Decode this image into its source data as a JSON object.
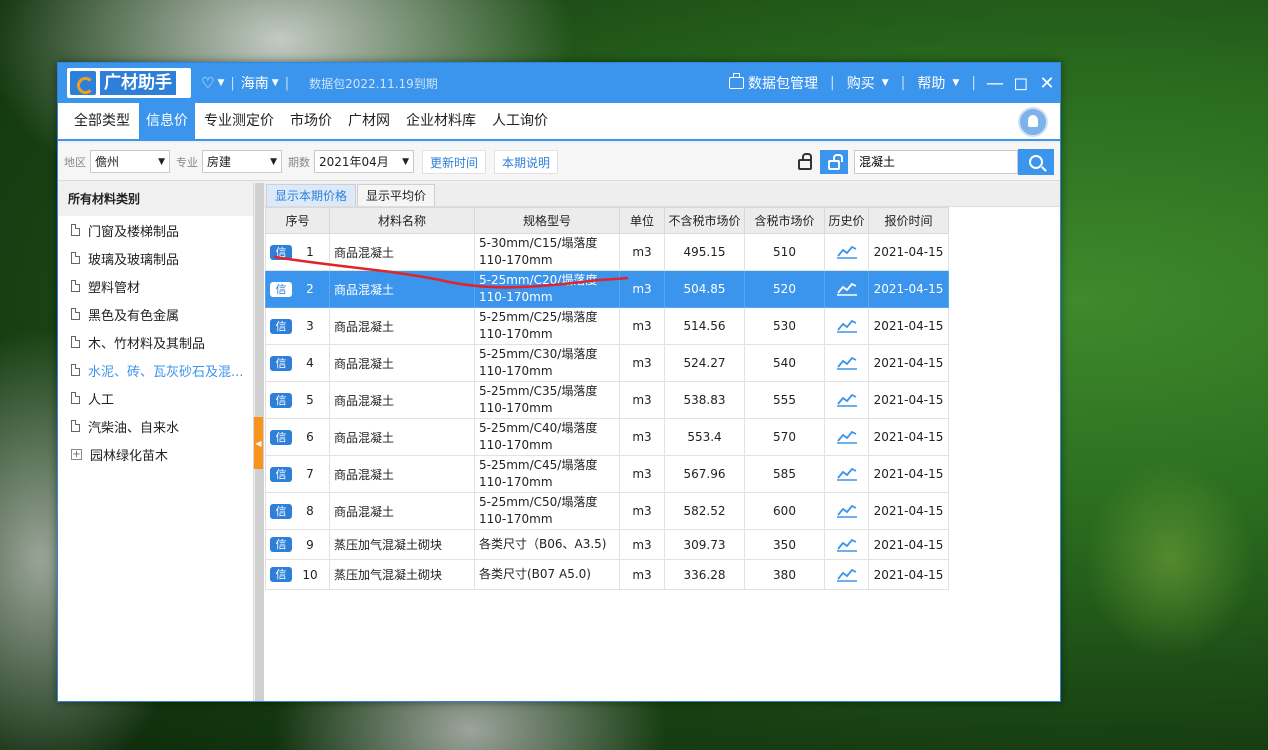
{
  "titlebar": {
    "logo": "广材助手",
    "region": "海南",
    "expire": "数据包2022.11.19到期",
    "package_mgmt": "数据包管理",
    "buy": "购买",
    "help": "帮助"
  },
  "tabs": [
    "全部类型",
    "信息价",
    "专业测定价",
    "市场价",
    "广材网",
    "企业材料库",
    "人工询价"
  ],
  "filters": {
    "area_label": "地区",
    "area_value": "儋州",
    "major_label": "专业",
    "major_value": "房建",
    "period_label": "期数",
    "period_value": "2021年04月",
    "update_btn": "更新时间",
    "desc_btn": "本期说明",
    "search_value": "混凝土"
  },
  "sidebar": {
    "header": "所有材料类别",
    "items": [
      {
        "label": "门窗及楼梯制品"
      },
      {
        "label": "玻璃及玻璃制品"
      },
      {
        "label": "塑料管材"
      },
      {
        "label": "黑色及有色金属"
      },
      {
        "label": "木、竹材料及其制品"
      },
      {
        "label": "水泥、砖、瓦灰砂石及混..."
      },
      {
        "label": "人工"
      },
      {
        "label": "汽柴油、自来水"
      },
      {
        "label": "园林绿化苗木"
      }
    ]
  },
  "subtabs": [
    "显示本期价格",
    "显示平均价"
  ],
  "table": {
    "headers": [
      "序号",
      "材料名称",
      "规格型号",
      "单位",
      "不含税市场价",
      "含税市场价",
      "历史价",
      "报价时间"
    ],
    "badge": "信",
    "rows": [
      {
        "idx": "1",
        "name": "商品混凝土",
        "spec1": "5-30mm/C15/塌落度",
        "spec2": "110-170mm",
        "unit": "m3",
        "price_ex": "495.15",
        "price_in": "510",
        "date": "2021-04-15"
      },
      {
        "idx": "2",
        "name": "商品混凝土",
        "spec1": "5-25mm/C20/塌落度",
        "spec2": "110-170mm",
        "unit": "m3",
        "price_ex": "504.85",
        "price_in": "520",
        "date": "2021-04-15"
      },
      {
        "idx": "3",
        "name": "商品混凝土",
        "spec1": "5-25mm/C25/塌落度",
        "spec2": "110-170mm",
        "unit": "m3",
        "price_ex": "514.56",
        "price_in": "530",
        "date": "2021-04-15"
      },
      {
        "idx": "4",
        "name": "商品混凝土",
        "spec1": "5-25mm/C30/塌落度",
        "spec2": "110-170mm",
        "unit": "m3",
        "price_ex": "524.27",
        "price_in": "540",
        "date": "2021-04-15"
      },
      {
        "idx": "5",
        "name": "商品混凝土",
        "spec1": "5-25mm/C35/塌落度",
        "spec2": "110-170mm",
        "unit": "m3",
        "price_ex": "538.83",
        "price_in": "555",
        "date": "2021-04-15"
      },
      {
        "idx": "6",
        "name": "商品混凝土",
        "spec1": "5-25mm/C40/塌落度",
        "spec2": "110-170mm",
        "unit": "m3",
        "price_ex": "553.4",
        "price_in": "570",
        "date": "2021-04-15"
      },
      {
        "idx": "7",
        "name": "商品混凝土",
        "spec1": "5-25mm/C45/塌落度",
        "spec2": "110-170mm",
        "unit": "m3",
        "price_ex": "567.96",
        "price_in": "585",
        "date": "2021-04-15"
      },
      {
        "idx": "8",
        "name": "商品混凝土",
        "spec1": "5-25mm/C50/塌落度",
        "spec2": "110-170mm",
        "unit": "m3",
        "price_ex": "582.52",
        "price_in": "600",
        "date": "2021-04-15"
      },
      {
        "idx": "9",
        "name": "蒸压加气混凝土砌块",
        "spec1": "各类尺寸（B06、A3.5)",
        "spec2": "",
        "unit": "m3",
        "price_ex": "309.73",
        "price_in": "350",
        "date": "2021-04-15"
      },
      {
        "idx": "10",
        "name": "蒸压加气混凝土砌块",
        "spec1": "各类尺寸(B07 A5.0)",
        "spec2": "",
        "unit": "m3",
        "price_ex": "336.28",
        "price_in": "380",
        "date": "2021-04-15"
      }
    ]
  },
  "colors": {
    "accent": "#3b95ec",
    "handle": "#f7941d",
    "annotation": "#e0242a"
  }
}
